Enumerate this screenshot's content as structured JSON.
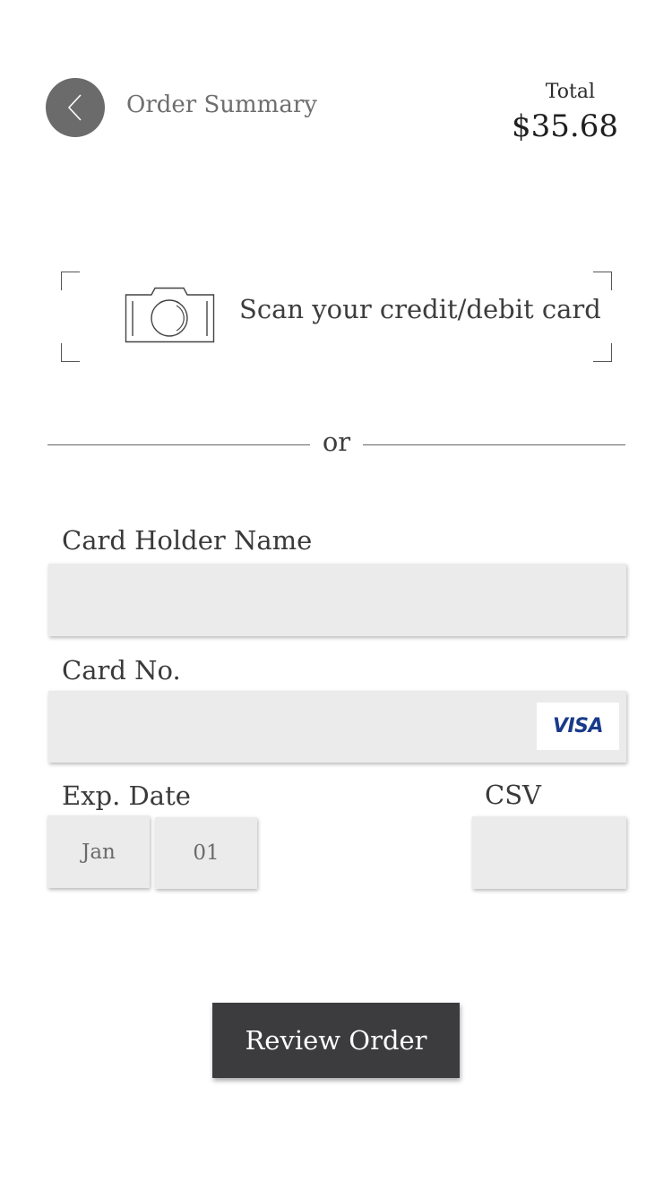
{
  "header": {
    "back_icon": "chevron-left-icon",
    "title": "Order Summary",
    "total_label": "Total",
    "total_value": "$35.68"
  },
  "scan": {
    "icon": "camera-icon",
    "label": "Scan your credit/debit card"
  },
  "divider": {
    "text": "or"
  },
  "form": {
    "card_holder": {
      "label": "Card Holder Name",
      "value": ""
    },
    "card_number": {
      "label": "Card No.",
      "value": "",
      "brand": "VISA"
    },
    "exp_date": {
      "label": "Exp. Date",
      "month": "Jan",
      "day": "01"
    },
    "csv": {
      "label": "CSV",
      "value": ""
    }
  },
  "actions": {
    "review_label": "Review Order"
  },
  "colors": {
    "back_button": "#6b6b6b",
    "input_bg": "#ebebeb",
    "primary_button": "#3c3c3e",
    "visa_blue": "#1a3a8a"
  }
}
